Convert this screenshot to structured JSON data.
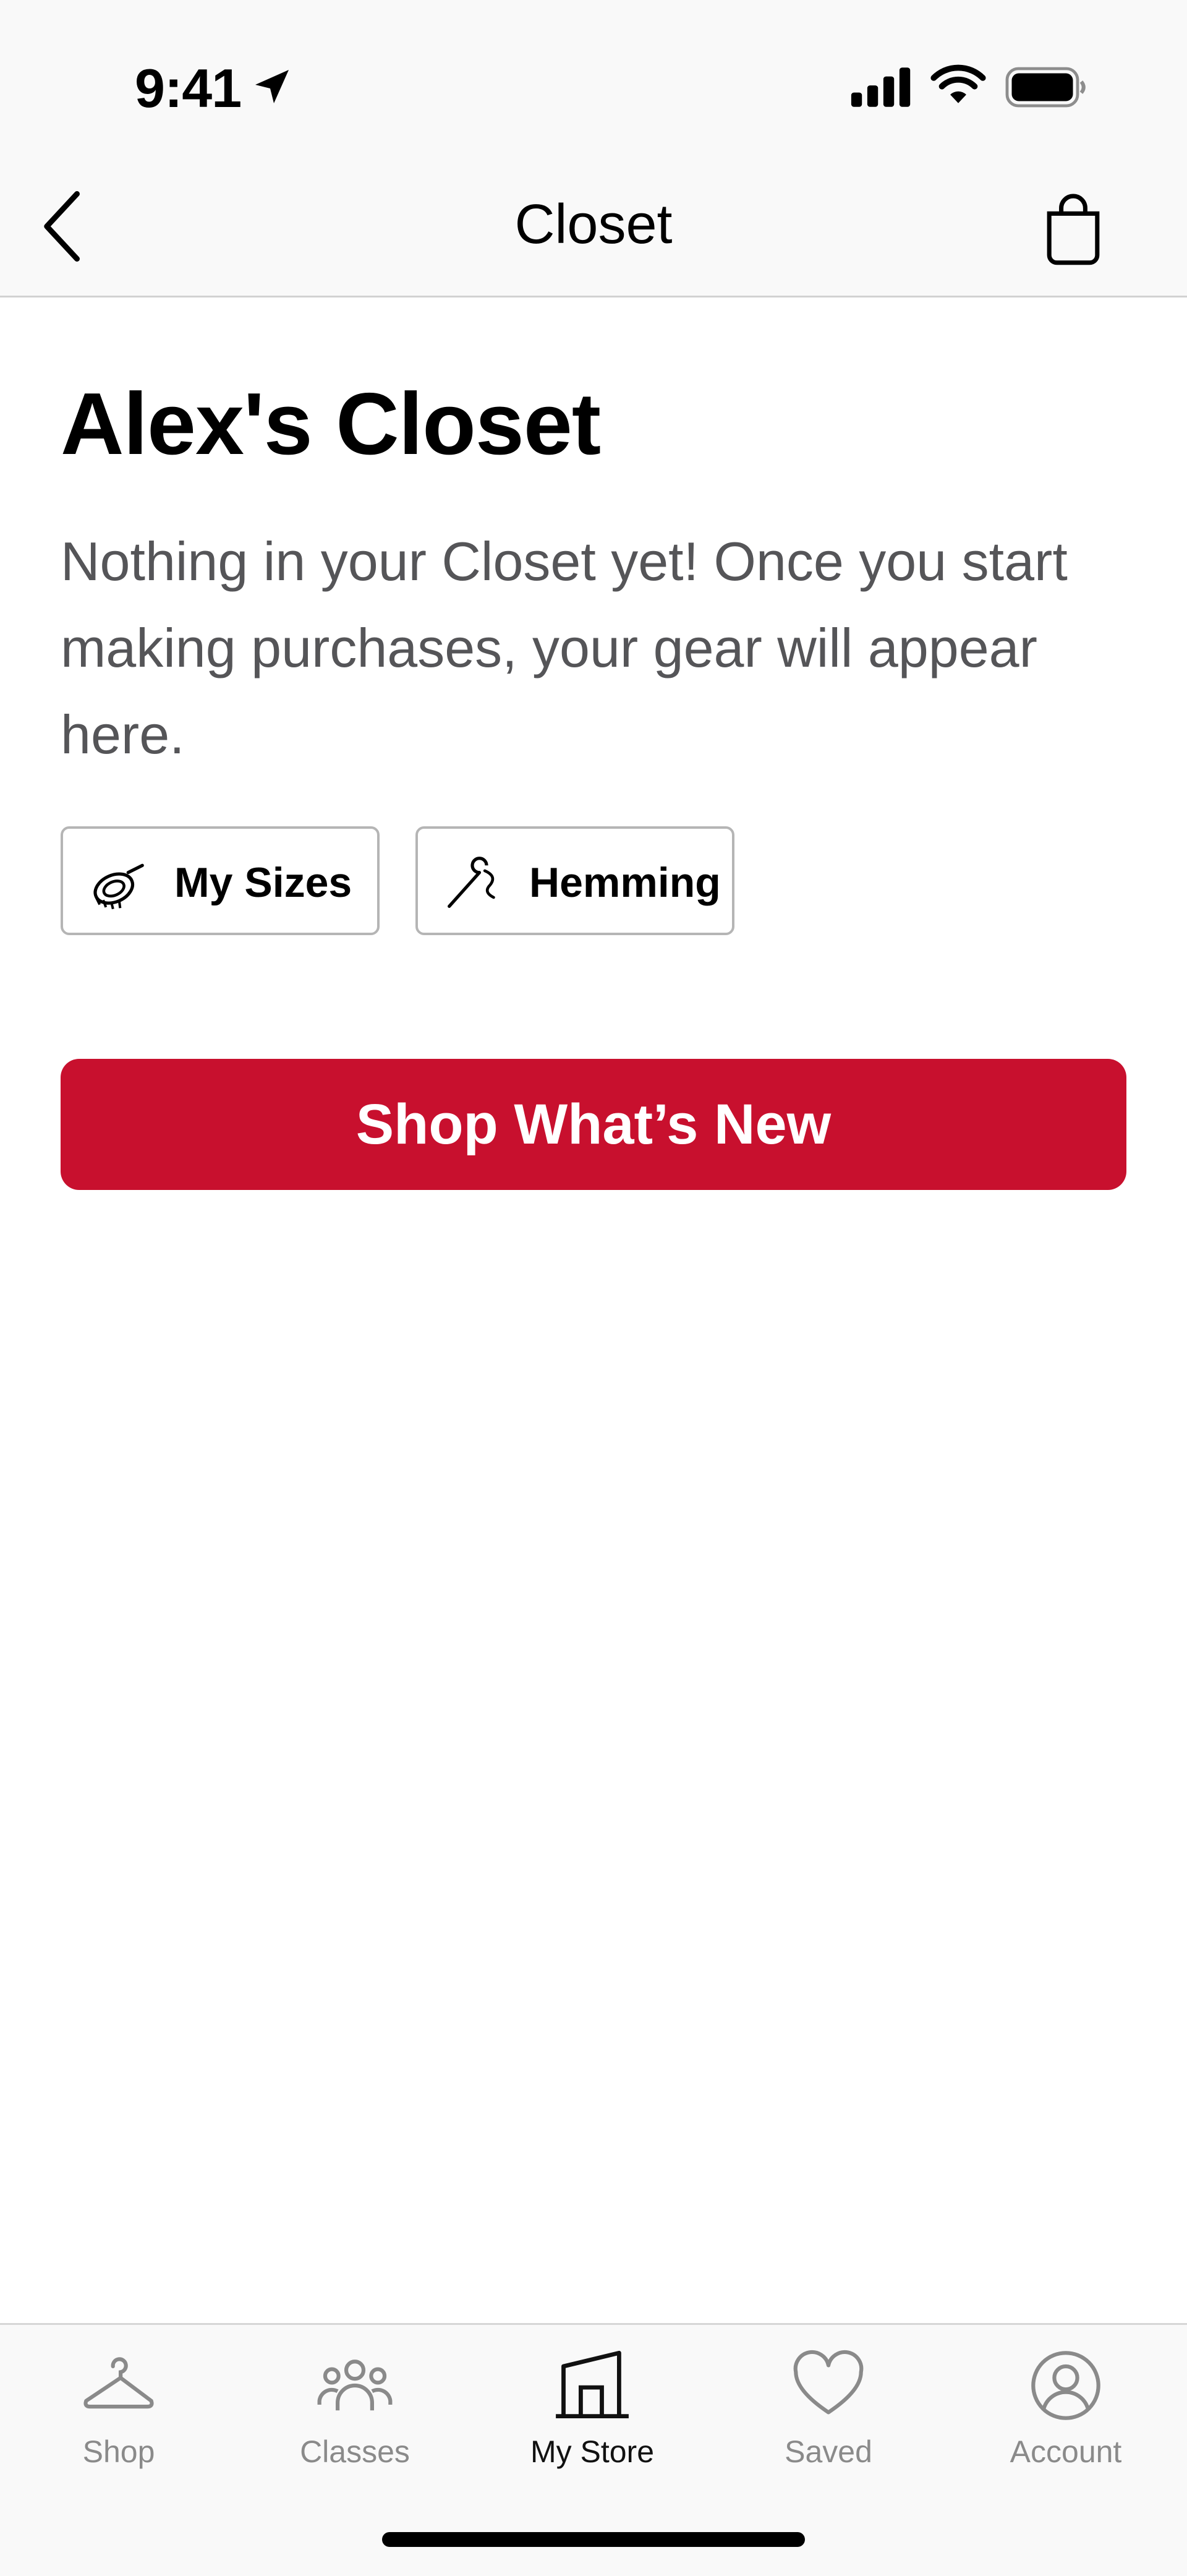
{
  "status_bar": {
    "time": "9:41",
    "icons": [
      "location-arrow-icon",
      "cellular-signal-icon",
      "wifi-icon",
      "battery-icon"
    ]
  },
  "nav": {
    "title": "Closet",
    "back_icon": "chevron-left-icon",
    "bag_icon": "shopping-bag-icon"
  },
  "closet": {
    "title": "Alex's Closet",
    "empty_message": "Nothing in your Closet yet! Once you start making purchases, your gear will appear here."
  },
  "chips": [
    {
      "label": "My Sizes",
      "icon": "measuring-tape-icon"
    },
    {
      "label": "Hemming",
      "icon": "needle-thread-icon"
    }
  ],
  "cta": {
    "label": "Shop What’s New",
    "color": "#c8102e"
  },
  "tabbar": {
    "tabs": [
      {
        "label": "Shop",
        "icon": "hanger-icon",
        "active": false
      },
      {
        "label": "Classes",
        "icon": "people-group-icon",
        "active": false
      },
      {
        "label": "My Store",
        "icon": "store-icon",
        "active": true
      },
      {
        "label": "Saved",
        "icon": "heart-icon",
        "active": false
      },
      {
        "label": "Account",
        "icon": "user-circle-icon",
        "active": false
      }
    ]
  }
}
